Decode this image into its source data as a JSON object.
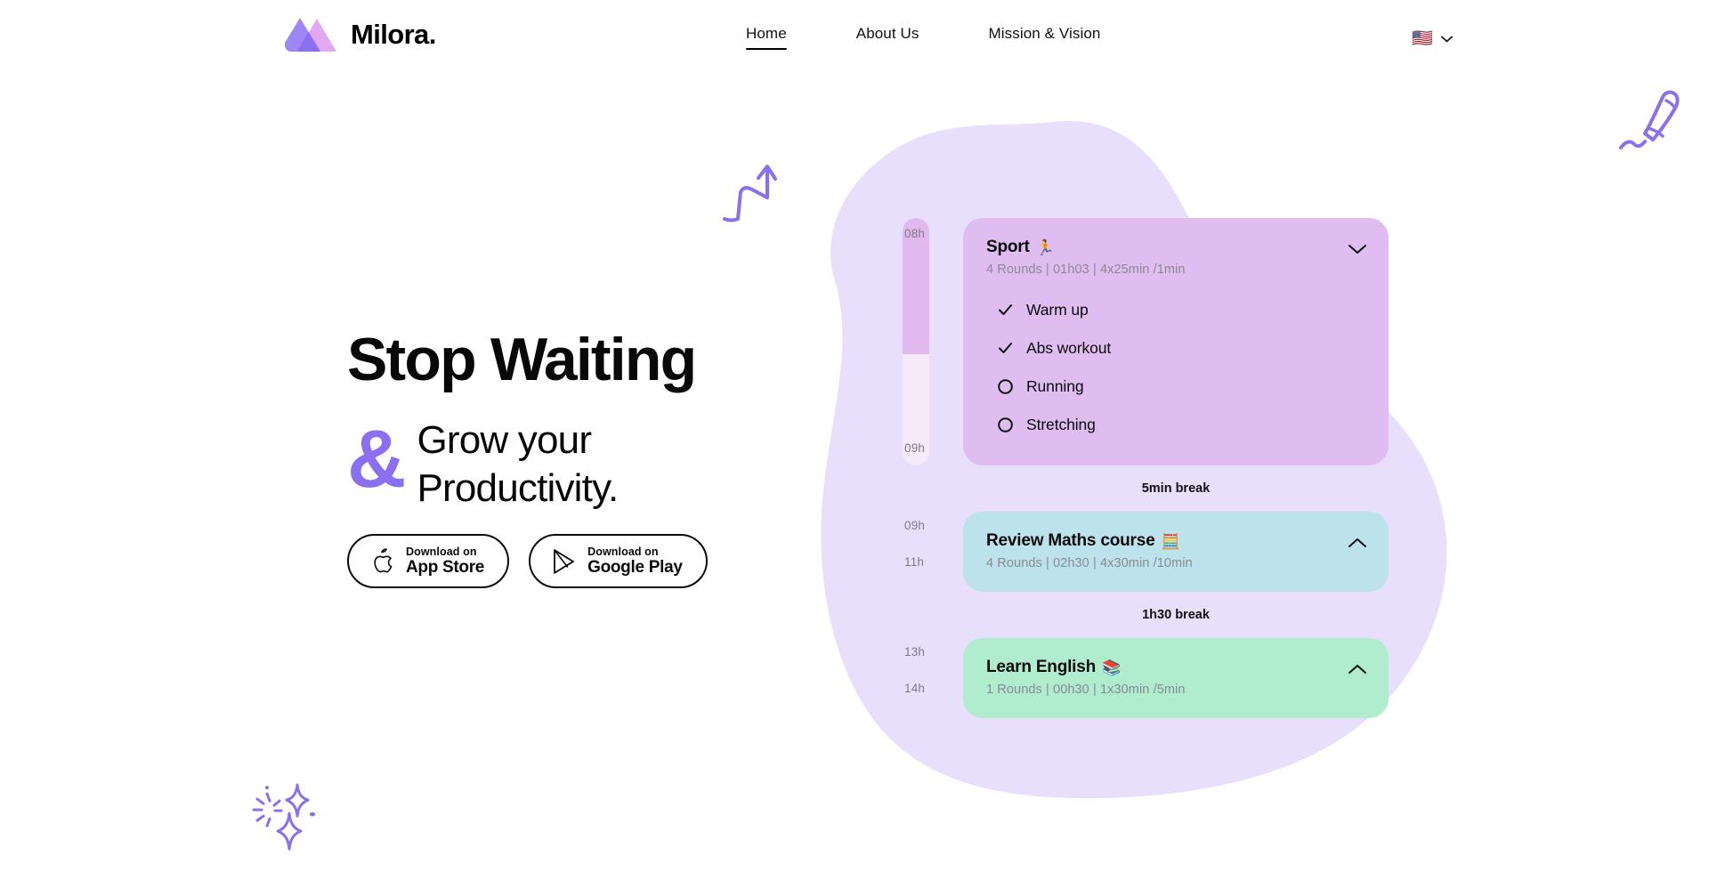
{
  "brand": {
    "name": "Milora.",
    "logo_icon": "mountain-logo-icon"
  },
  "nav": {
    "items": [
      {
        "label": "Home",
        "active": true
      },
      {
        "label": "About Us",
        "active": false
      },
      {
        "label": "Mission & Vision",
        "active": false
      }
    ]
  },
  "language": {
    "flag": "🇺🇸",
    "chevron_icon": "chevron-down-icon"
  },
  "hero": {
    "title": "Stop Waiting",
    "ampersand": "&",
    "subtitle_line1": "Grow your",
    "subtitle_line2": "Productivity.",
    "accent_color": "#8A70F0"
  },
  "store_buttons": [
    {
      "small": "Download on",
      "big": "App Store",
      "icon": "apple-logo-icon"
    },
    {
      "small": "Download on",
      "big": "Google Play",
      "icon": "google-play-icon"
    }
  ],
  "doodles": [
    {
      "name": "growth-arrow-doodle",
      "color": "#8A70F0"
    },
    {
      "name": "pencil-doodle",
      "color": "#8A70F0"
    },
    {
      "name": "sparkle-doodle",
      "color": "#8A70F0"
    }
  ],
  "schedule": {
    "blob_color": "#E7DFFB",
    "blocks": [
      {
        "id": "sport",
        "title": "Sport",
        "emoji": "🏃",
        "meta": "4 Rounds  | 01h03 | 4x25min /1min",
        "color": "#E0BDF1",
        "expanded": true,
        "toggle_icon": "chevron-down-icon",
        "start_time": "08h",
        "end_time": "09h",
        "progress_percent": 55,
        "tasks": [
          {
            "label": "Warm up",
            "done": true
          },
          {
            "label": "Abs workout",
            "done": true
          },
          {
            "label": "Running",
            "done": false
          },
          {
            "label": "Stretching",
            "done": false
          }
        ]
      },
      {
        "id": "maths",
        "title": "Review Maths course",
        "emoji": "🧮",
        "meta": "4 Rounds  | 02h30 | 4x30min /10min",
        "color": "#BCE3EC",
        "expanded": false,
        "toggle_icon": "chevron-up-icon",
        "start_time": "09h",
        "end_time": "11h",
        "tasks": []
      },
      {
        "id": "english",
        "title": "Learn English",
        "emoji": "📚",
        "meta": "1 Rounds  | 00h30 | 1x30min /5min",
        "color": "#AFEDCE",
        "expanded": false,
        "toggle_icon": "chevron-up-icon",
        "start_time": "13h",
        "end_time": "14h",
        "tasks": []
      }
    ],
    "breaks": [
      {
        "label": "5min break"
      },
      {
        "label": "1h30 break"
      }
    ]
  }
}
